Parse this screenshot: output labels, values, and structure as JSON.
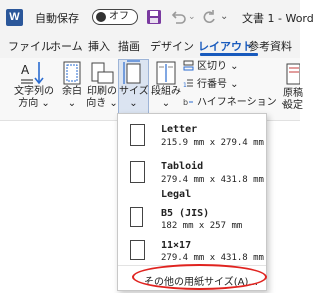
{
  "titlebar": {
    "app_letter": "W",
    "autosave_label": "自動保存",
    "autosave_state": "オフ",
    "more_symbol": "⌄",
    "undo_drop": "⌄",
    "doc_title": "文書 1 - Word"
  },
  "tabs": [
    {
      "label": "ファイル"
    },
    {
      "label": "ホーム"
    },
    {
      "label": "挿入"
    },
    {
      "label": "描画"
    },
    {
      "label": "デザイン"
    },
    {
      "label": "レイアウト",
      "active": true
    },
    {
      "label": "参考資料"
    }
  ],
  "ribbon": {
    "text_direction": "文字列の\n方向 ⌄",
    "margins": "余白\n⌄",
    "orientation": "印刷の\n向き ⌄",
    "size": "サイズ\n⌄",
    "columns": "段組み\n⌄",
    "breaks": "区切り ⌄",
    "line_numbers": "行番号 ⌄",
    "hyphenation": "ハイフネーション ⌄",
    "right_cut_1": "原稿\n設定",
    "right_cut_2": "原稿"
  },
  "size_menu": {
    "items": [
      {
        "name": "Letter",
        "dims": "215.9 mm x 279.4 mm"
      },
      {
        "name": "Tabloid",
        "dims": "279.4 mm x 431.8 mm"
      },
      {
        "name": "Legal",
        "dims": ""
      },
      {
        "name": "B5 (JIS)",
        "dims": "182 mm x 257 mm"
      },
      {
        "name": "11×17",
        "dims": "279.4 mm x 431.8 mm"
      }
    ],
    "more_label": "その他の用紙サイズ(A)..."
  },
  "colors": {
    "accent": "#185abd",
    "highlight_ellipse": "#e0231f",
    "save_icon": "#7a3aa0"
  }
}
